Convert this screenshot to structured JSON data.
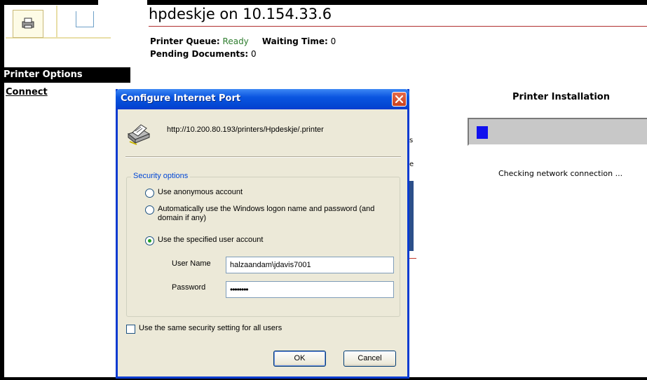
{
  "header": {
    "title": "hpdeskje on 10.154.33.6",
    "queue_label": "Printer Queue:",
    "queue_value": "Ready",
    "waiting_label": "Waiting Time:",
    "waiting_value": "0",
    "pending_label": "Pending Documents:",
    "pending_value": "0"
  },
  "nav": {
    "header": "Printer Options",
    "connect": "Connect"
  },
  "background_fragments": [
    "s",
    "e",
    "s"
  ],
  "install": {
    "title": "Printer Installation",
    "progress_fraction": 0.07,
    "status_text": "Checking network connection ..."
  },
  "dialog": {
    "title": "Configure Internet Port",
    "url": "http://10.200.80.193/printers/Hpdeskje/.printer",
    "group_label": "Security options",
    "radio_anonymous": "Use anonymous account",
    "radio_windows_line1": "Automatically use the Windows logon name and password (and",
    "radio_windows_line2": "domain if any)",
    "radio_specified": "Use the specified user account",
    "selected_option": "specified",
    "username_label": "User Name",
    "username_value": "halzaandam\\jdavis7001",
    "password_label": "Password",
    "password_value": "••••••••",
    "same_setting_label": "Use the same security setting for all users",
    "same_setting_checked": false,
    "ok_label": "OK",
    "cancel_label": "Cancel"
  },
  "colors": {
    "titlebar": "#0a55e0",
    "progress": "#1010ee",
    "ready": "#2e7d2e",
    "group_label": "#0046d5"
  }
}
